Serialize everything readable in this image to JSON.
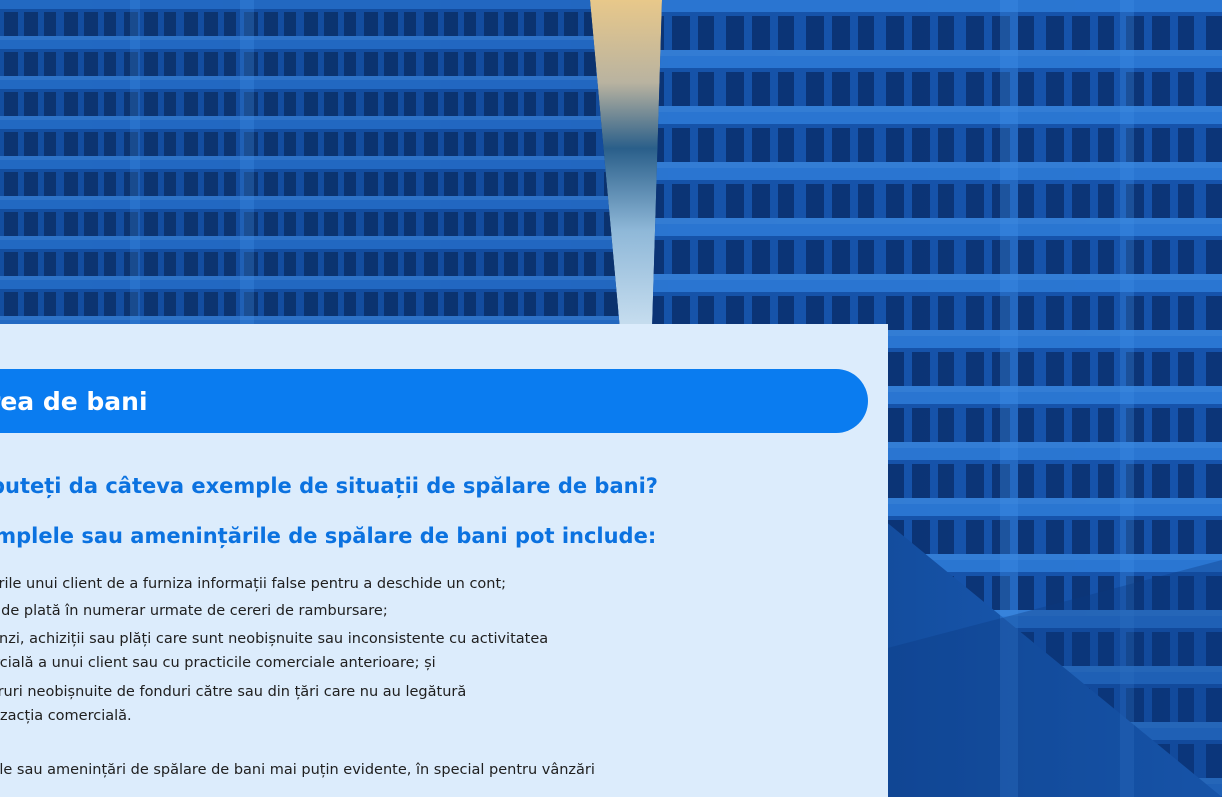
{
  "section": {
    "title": "rea de bani",
    "question": "puteți da câteva exemple de situații de spălare de bani?",
    "subheading": "emplele sau amenințările de spălare de bani pot include:",
    "bullets": [
      "rcările unui client de a furniza informații false pentru a deschide un cont;",
      "rte de plată în numerar urmate de cereri de rambursare;",
      "menzi, achiziții sau plăți care sunt neobișnuite sau inconsistente cu activitatea",
      "nercială a unui client sau cu practicile comerciale anterioare; și",
      "sferuri neobișnuite de fonduri către sau din țări care nu au legătură",
      "ranzacția comercială."
    ],
    "footer_line": "mple sau amenințări de spălare de bani mai puțin evidente, în special pentru vânzări"
  },
  "colors": {
    "banner": "#0a7cf0",
    "heading": "#0b72e0",
    "panel": "#dcecfc",
    "body_text": "#202020"
  }
}
